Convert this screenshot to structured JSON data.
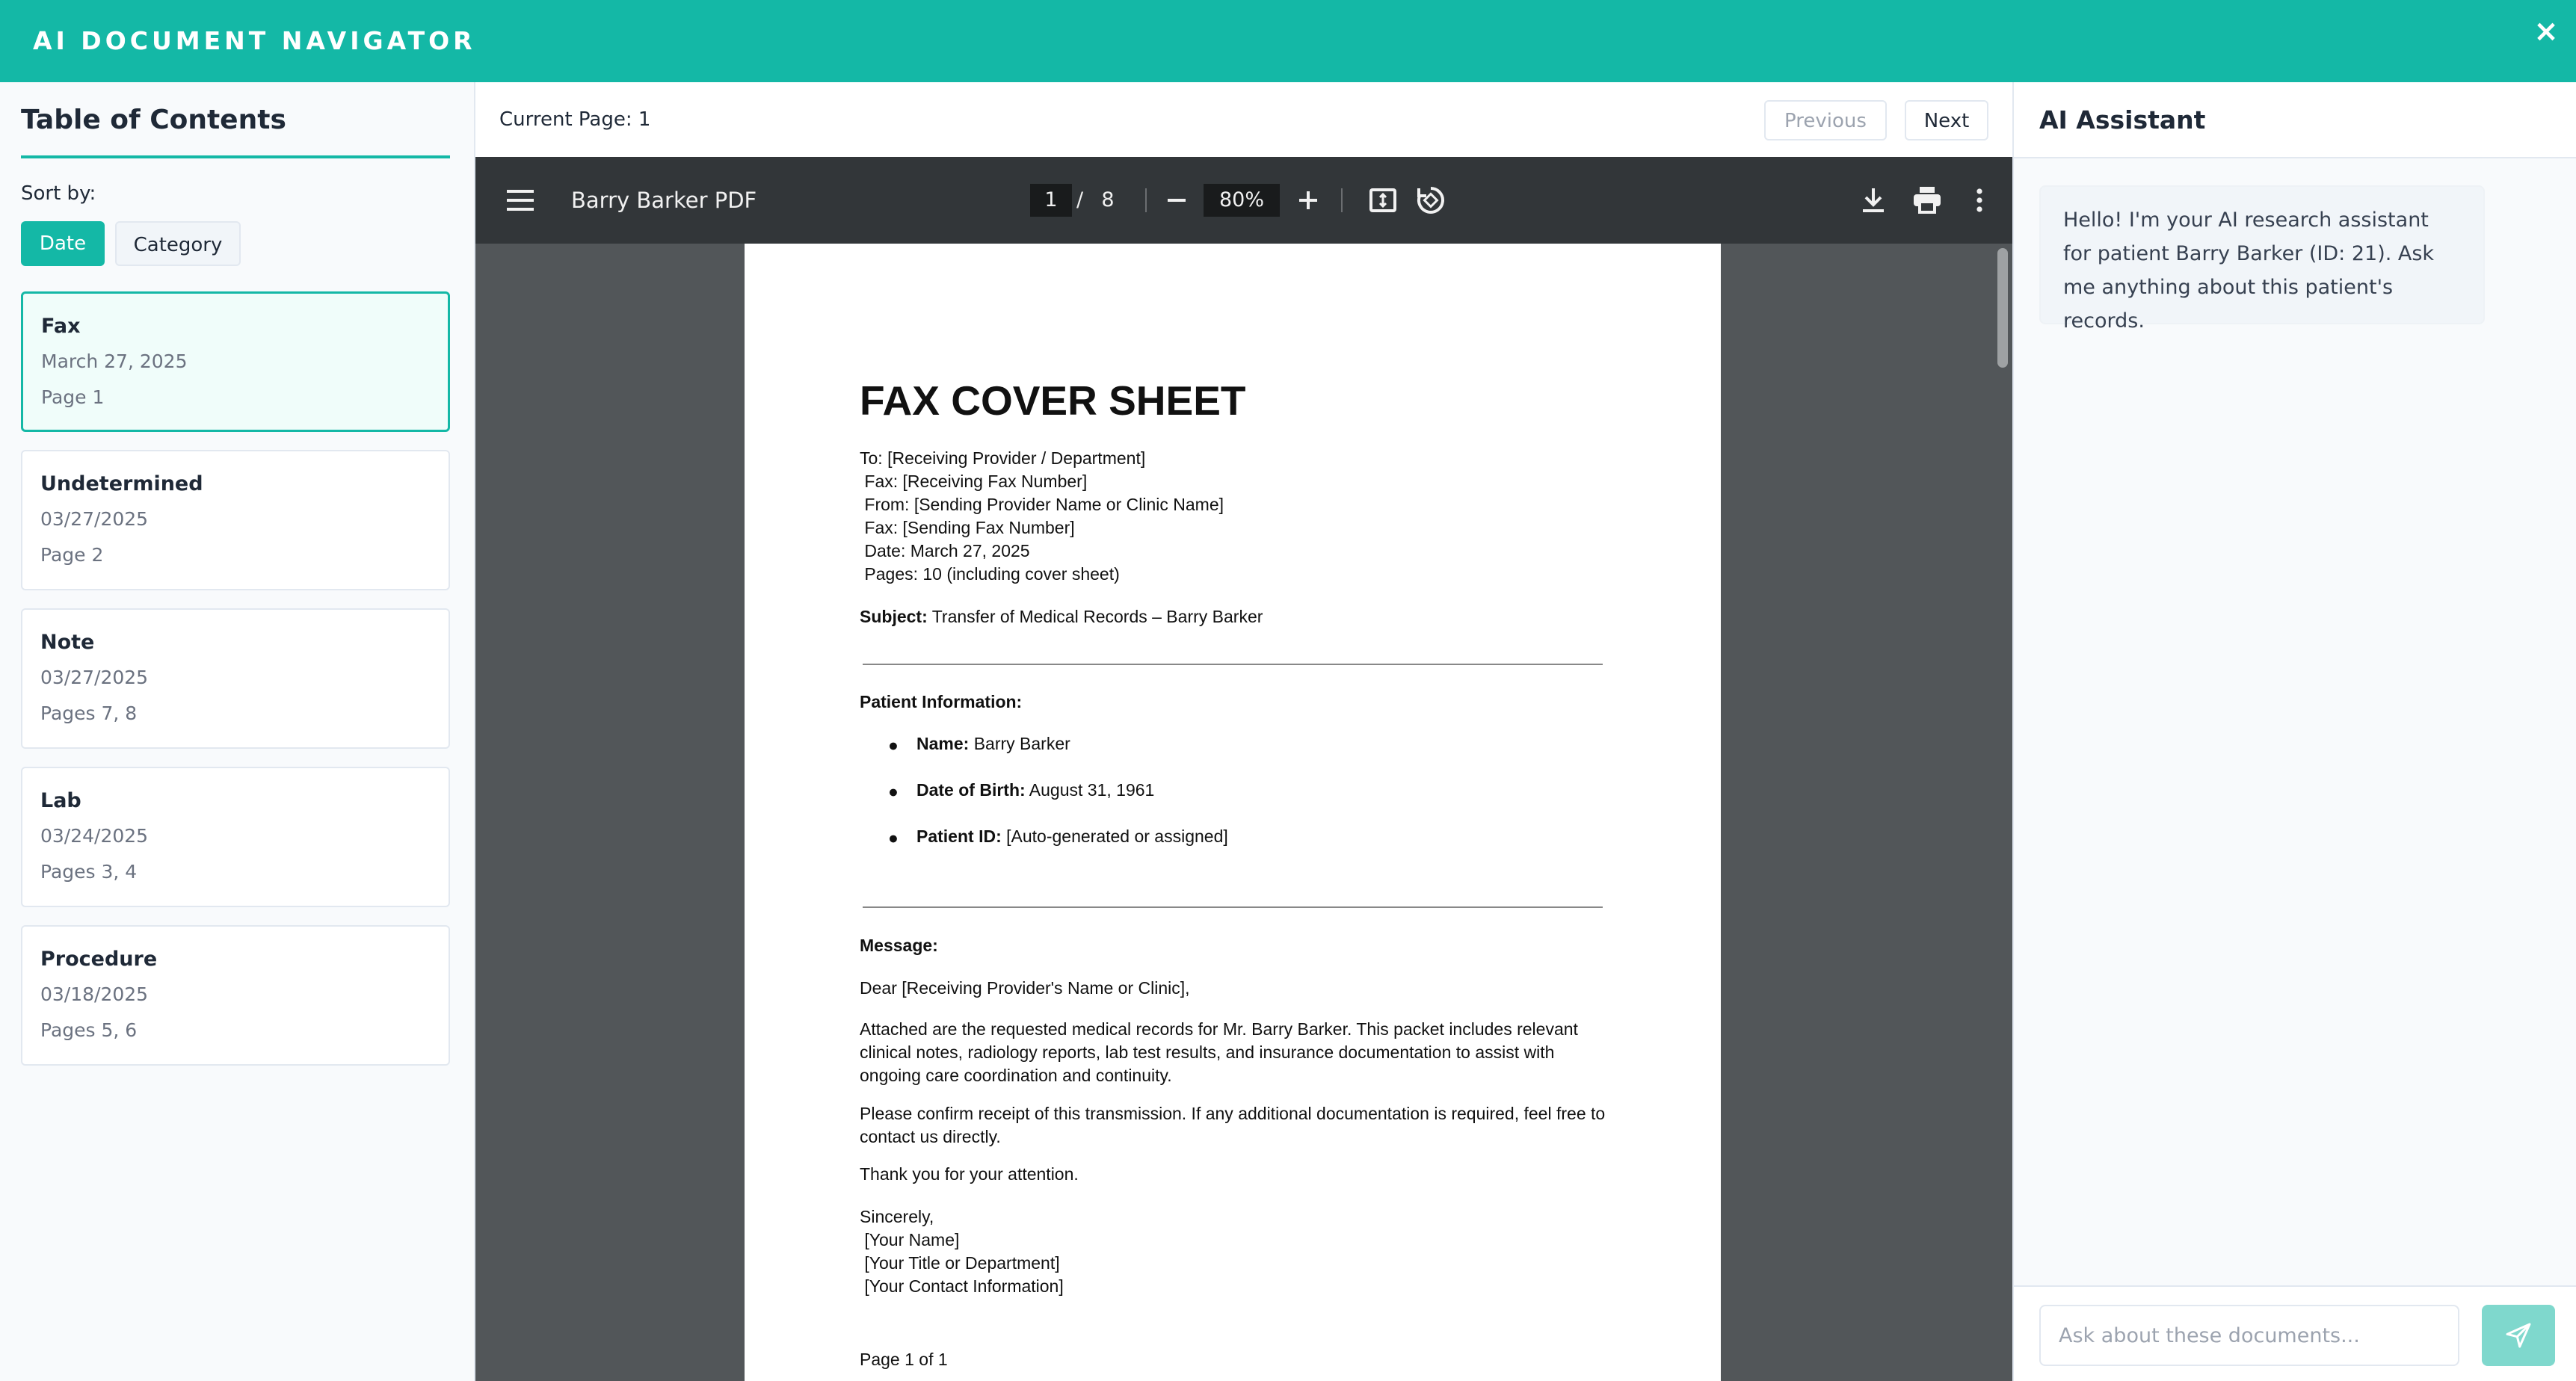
{
  "app": {
    "title": "AI DOCUMENT NAVIGATOR",
    "close_icon": "×"
  },
  "sidebar": {
    "title": "Table of Contents",
    "sort_label": "Sort by:",
    "sort_options": [
      "Date",
      "Category"
    ],
    "items": [
      {
        "category": "Fax",
        "date": "March 27, 2025",
        "pages": "Page 1",
        "active": true
      },
      {
        "category": "Undetermined",
        "date": "03/27/2025",
        "pages": "Page 2"
      },
      {
        "category": "Note",
        "date": "03/27/2025",
        "pages": "Pages 7, 8"
      },
      {
        "category": "Lab",
        "date": "03/24/2025",
        "pages": "Pages 3, 4"
      },
      {
        "category": "Procedure",
        "date": "03/18/2025",
        "pages": "Pages 5, 6"
      }
    ]
  },
  "center": {
    "current_page": "Current Page: 1",
    "previous": "Previous",
    "next": "Next"
  },
  "viewer": {
    "file_name": "Barry Barker PDF",
    "page": "1",
    "page_sep": "/",
    "page_total": "8",
    "zoom": "80%"
  },
  "document": {
    "title": "FAX COVER SHEET",
    "to": "To: [Receiving Provider / Department]",
    "fax_to": " Fax: [Receiving Fax Number]",
    "from": " From: [Sending Provider Name or Clinic Name]",
    "fax_from": " Fax: [Sending Fax Number]",
    "date": " Date: March 27, 2025",
    "pages": " Pages: 10 (including cover sheet)",
    "subject_label": "Subject:",
    "subject": " Transfer of Medical Records – Barry Barker",
    "patient_info_heading": "Patient Information:",
    "bullet": "●",
    "name_label": "Name:",
    "name": " Barry Barker",
    "dob_label": "Date of Birth:",
    "dob": " August 31, 1961",
    "pid_label": "Patient ID:",
    "pid": " [Auto-generated or assigned]",
    "message_heading": "Message:",
    "greeting": "Dear [Receiving Provider's Name or Clinic],",
    "para1": "Attached are the requested medical records for Mr. Barry Barker. This packet includes relevant clinical notes, radiology reports, lab test results, and insurance documentation to assist with ongoing care coordination and continuity.",
    "para2": "Please confirm receipt of this transmission. If any additional documentation is required, feel free to contact us directly.",
    "thanks": "Thank you for your attention.",
    "sincerely": "Sincerely,",
    "sig_name": " [Your Name]",
    "sig_title": " [Your Title or Department]",
    "sig_contact": " [Your Contact Information]",
    "footer": "Page 1 of 1"
  },
  "ai": {
    "title": "AI Assistant",
    "message": "Hello! I'm your AI research assistant for patient Barry Barker (ID: 21). Ask me anything about this patient's records.",
    "input_placeholder": "Ask about these documents..."
  },
  "colors": {
    "accent": "#14b8a6",
    "viewer_bg": "#525659",
    "toolbar_bg": "#323639"
  }
}
